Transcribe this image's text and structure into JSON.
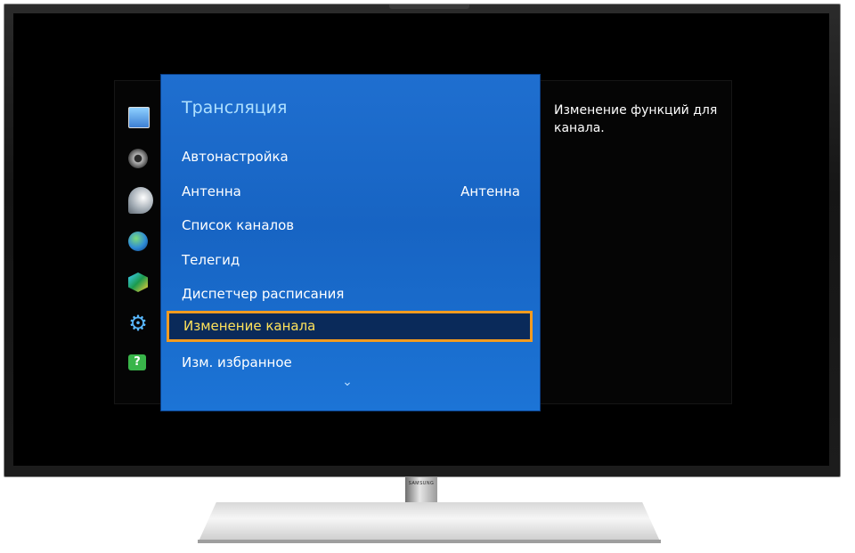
{
  "tv": {
    "brand": "SAMSUNG"
  },
  "sidebar": {
    "icons": [
      {
        "name": "picture-icon"
      },
      {
        "name": "sound-icon"
      },
      {
        "name": "broadcast-icon"
      },
      {
        "name": "network-icon"
      },
      {
        "name": "smart-features-icon"
      },
      {
        "name": "system-icon",
        "glyph": "⚙"
      },
      {
        "name": "support-icon",
        "glyph": "?"
      }
    ]
  },
  "menu": {
    "title": "Трансляция",
    "items": [
      {
        "label": "Автонастройка"
      },
      {
        "label": "Антенна",
        "value": "Антенна"
      },
      {
        "label": "Список каналов"
      },
      {
        "label": "Телегид"
      },
      {
        "label": "Диспетчер расписания"
      },
      {
        "label": "Изменение канала",
        "selected": true
      },
      {
        "label": "Изм. избранное"
      }
    ],
    "scroll_glyph": "⌄"
  },
  "description": "Изменение функций для канала.",
  "colors": {
    "selection_border": "#f39b1f",
    "selected_text": "#ffe25a",
    "panel": "#1764c3"
  }
}
